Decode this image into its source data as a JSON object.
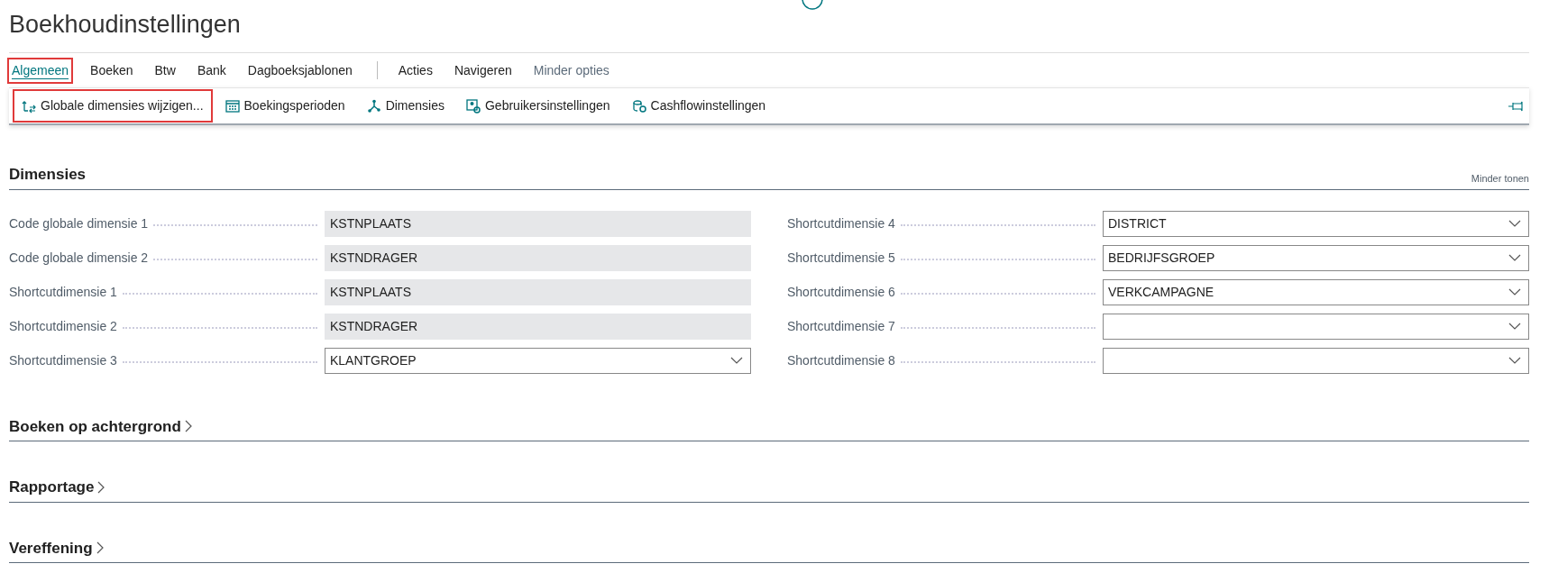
{
  "page": {
    "title": "Boekhoudinstellingen"
  },
  "tabs": [
    {
      "label": "Algemeen",
      "selected": true,
      "highlighted": true,
      "kind": "tab"
    },
    {
      "label": "Boeken",
      "selected": false,
      "highlighted": false,
      "kind": "tab"
    },
    {
      "label": "Btw",
      "selected": false,
      "highlighted": false,
      "kind": "tab"
    },
    {
      "label": "Bank",
      "selected": false,
      "highlighted": false,
      "kind": "tab"
    },
    {
      "label": "Dagboeksjablonen",
      "selected": false,
      "highlighted": false,
      "kind": "tab"
    },
    {
      "label": "Acties",
      "selected": false,
      "highlighted": false,
      "kind": "menu"
    },
    {
      "label": "Navigeren",
      "selected": false,
      "highlighted": false,
      "kind": "menu"
    },
    {
      "label": "Minder opties",
      "selected": false,
      "highlighted": false,
      "kind": "toggle"
    }
  ],
  "actions": [
    {
      "label": "Globale dimensies wijzigen...",
      "highlighted": true
    },
    {
      "label": "Boekingsperioden",
      "highlighted": false
    },
    {
      "label": "Dimensies",
      "highlighted": false
    },
    {
      "label": "Gebruikersinstellingen",
      "highlighted": false
    },
    {
      "label": "Cashflowinstellingen",
      "highlighted": false
    }
  ],
  "sections": [
    {
      "title": "Dimensies",
      "expanded": true,
      "toggle": "Minder tonen",
      "columns": [
        [
          {
            "label": "Code globale dimensie 1",
            "value": "KSTNPLAATS",
            "kind": "readonly"
          },
          {
            "label": "Code globale dimensie 2",
            "value": "KSTNDRAGER",
            "kind": "readonly"
          },
          {
            "label": "Shortcutdimensie 1",
            "value": "KSTNPLAATS",
            "kind": "readonly"
          },
          {
            "label": "Shortcutdimensie 2",
            "value": "KSTNDRAGER",
            "kind": "readonly"
          },
          {
            "label": "Shortcutdimensie 3",
            "value": "KLANTGROEP",
            "kind": "dropdown"
          }
        ],
        [
          {
            "label": "Shortcutdimensie 4",
            "value": "DISTRICT",
            "kind": "dropdown"
          },
          {
            "label": "Shortcutdimensie 5",
            "value": "BEDRIJFSGROEP",
            "kind": "dropdown"
          },
          {
            "label": "Shortcutdimensie 6",
            "value": "VERKCAMPAGNE",
            "kind": "dropdown"
          },
          {
            "label": "Shortcutdimensie 7",
            "kind": "dropdown"
          },
          {
            "label": "Shortcutdimensie 8",
            "kind": "dropdown"
          }
        ]
      ]
    },
    {
      "title": "Boeken op achtergrond",
      "expanded": false
    },
    {
      "title": "Rapportage",
      "expanded": false
    },
    {
      "title": "Vereffening",
      "expanded": false
    }
  ]
}
